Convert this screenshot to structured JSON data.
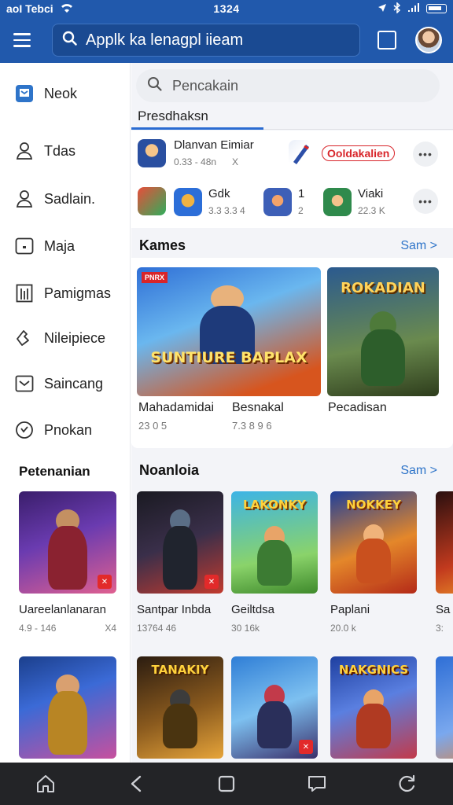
{
  "status_bar": {
    "carrier": "aoI Tebci",
    "time": "1324",
    "icons": [
      "wifi-icon",
      "location-icon",
      "bluetooth-icon",
      "signal-icon",
      "battery-icon"
    ]
  },
  "app_bar": {
    "search_text": "Applk ka lenagpl iieam",
    "icons": [
      "menu-icon",
      "search-icon",
      "window-icon",
      "avatar"
    ]
  },
  "sidebar": {
    "items": [
      {
        "label": "Neok",
        "icon": "app-icon"
      },
      {
        "label": "Tdas",
        "icon": "person-icon"
      },
      {
        "label": "Sadlain.",
        "icon": "person-icon"
      },
      {
        "label": "Maja",
        "icon": "tablet-icon"
      },
      {
        "label": "Pamigmas",
        "icon": "bars-icon"
      },
      {
        "label": "Nileipiece",
        "icon": "puzzle-icon"
      },
      {
        "label": "Saincang",
        "icon": "inbox-icon"
      },
      {
        "label": "Pnokan",
        "icon": "heart-icon"
      }
    ],
    "section_title": "Petenanian",
    "cards": [
      {
        "title": "Uareelanlanaran",
        "meta": "4.9 - 146",
        "meta2": "X4"
      },
      {
        "title": "",
        "meta": "",
        "meta2": ""
      }
    ]
  },
  "main": {
    "search_placeholder": "Pencakain",
    "tab_label": "Presdhaksn",
    "quick_rows": [
      {
        "items": [
          {
            "title": "Dlanvan Eimiar",
            "meta": "0.33 - 48n",
            "meta2": "X"
          },
          {
            "title": "Ooldakalien",
            "meta": "",
            "meta2": ""
          }
        ]
      },
      {
        "items": [
          {
            "title": "Gdk",
            "meta": "3.3 3.3 4"
          },
          {
            "title": "1",
            "meta": "2"
          },
          {
            "title": "Viaki",
            "meta": "22.3 K"
          }
        ]
      }
    ],
    "more_label": "•••",
    "games_section": {
      "title": "Kames",
      "link": "Sam >",
      "featured": [
        {
          "title": "Mahadamidai",
          "meta": "23 0 5",
          "art": "SUNTIURE BAPLAX",
          "badge": "PNRX"
        },
        {
          "title": "Besnakal",
          "meta": "7.3 8 9 6"
        },
        {
          "title": "Pecadisan",
          "meta": "",
          "art": "ROKADIAN"
        }
      ]
    },
    "second_section": {
      "title": "Noanloia",
      "link": "Sam >",
      "cards": [
        {
          "title": "Santpar Inbda",
          "meta": "13764 46"
        },
        {
          "title": "Geiltdsa",
          "meta": "30 16k",
          "art": "LAKONKY"
        },
        {
          "title": "Paplani",
          "meta": "20.0 k",
          "art": "NOKKEY"
        },
        {
          "title": "Sa",
          "meta": "3:"
        }
      ],
      "cards_row2": [
        {
          "art": "TANAKIY"
        },
        {
          "art": ""
        },
        {
          "art": "NAKGNICS"
        },
        {
          "art": ""
        }
      ]
    }
  },
  "bottom_nav": {
    "icons": [
      "home-icon",
      "back-icon",
      "square-icon",
      "chat-icon",
      "refresh-icon"
    ]
  },
  "colors": {
    "primary": "#2159ac",
    "accent": "#2e74c9",
    "nav": "#232427"
  }
}
